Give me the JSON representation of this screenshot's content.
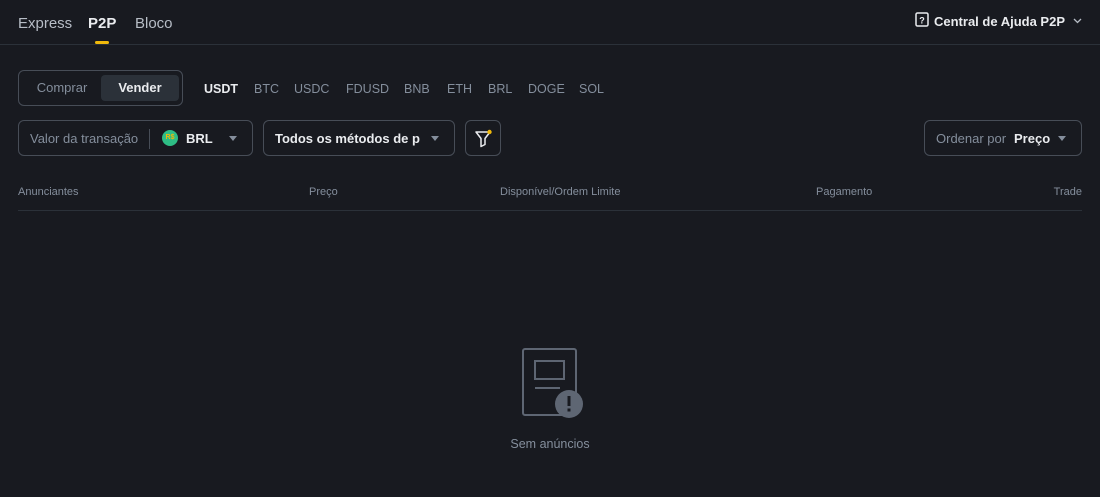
{
  "nav": {
    "tabs": [
      {
        "label": "Express"
      },
      {
        "label": "P2P",
        "active": true
      },
      {
        "label": "Bloco"
      }
    ],
    "help_label": "Central de Ajuda P2P",
    "accent_color": "#f0b90b"
  },
  "trade_type": {
    "buy_label": "Comprar",
    "sell_label": "Vender",
    "selected": "Vender"
  },
  "coins": [
    "USDT",
    "BTC",
    "USDC",
    "FDUSD",
    "BNB",
    "ETH",
    "BRL",
    "DOGE",
    "SOL"
  ],
  "coins_selected": "USDT",
  "filters": {
    "amount_placeholder": "Valor da transação",
    "currency_icon": "R$",
    "currency": "BRL",
    "payment_method": "Todos os métodos de pagamento",
    "sort_label": "Ordenar por",
    "sort_value": "Preço"
  },
  "table": {
    "headers": [
      "Anunciantes",
      "Preço",
      "Disponível/Ordem Limite",
      "Pagamento",
      "Trade"
    ]
  },
  "empty_state": {
    "message": "Sem anúncios",
    "icon": "no-ads-document-icon"
  }
}
